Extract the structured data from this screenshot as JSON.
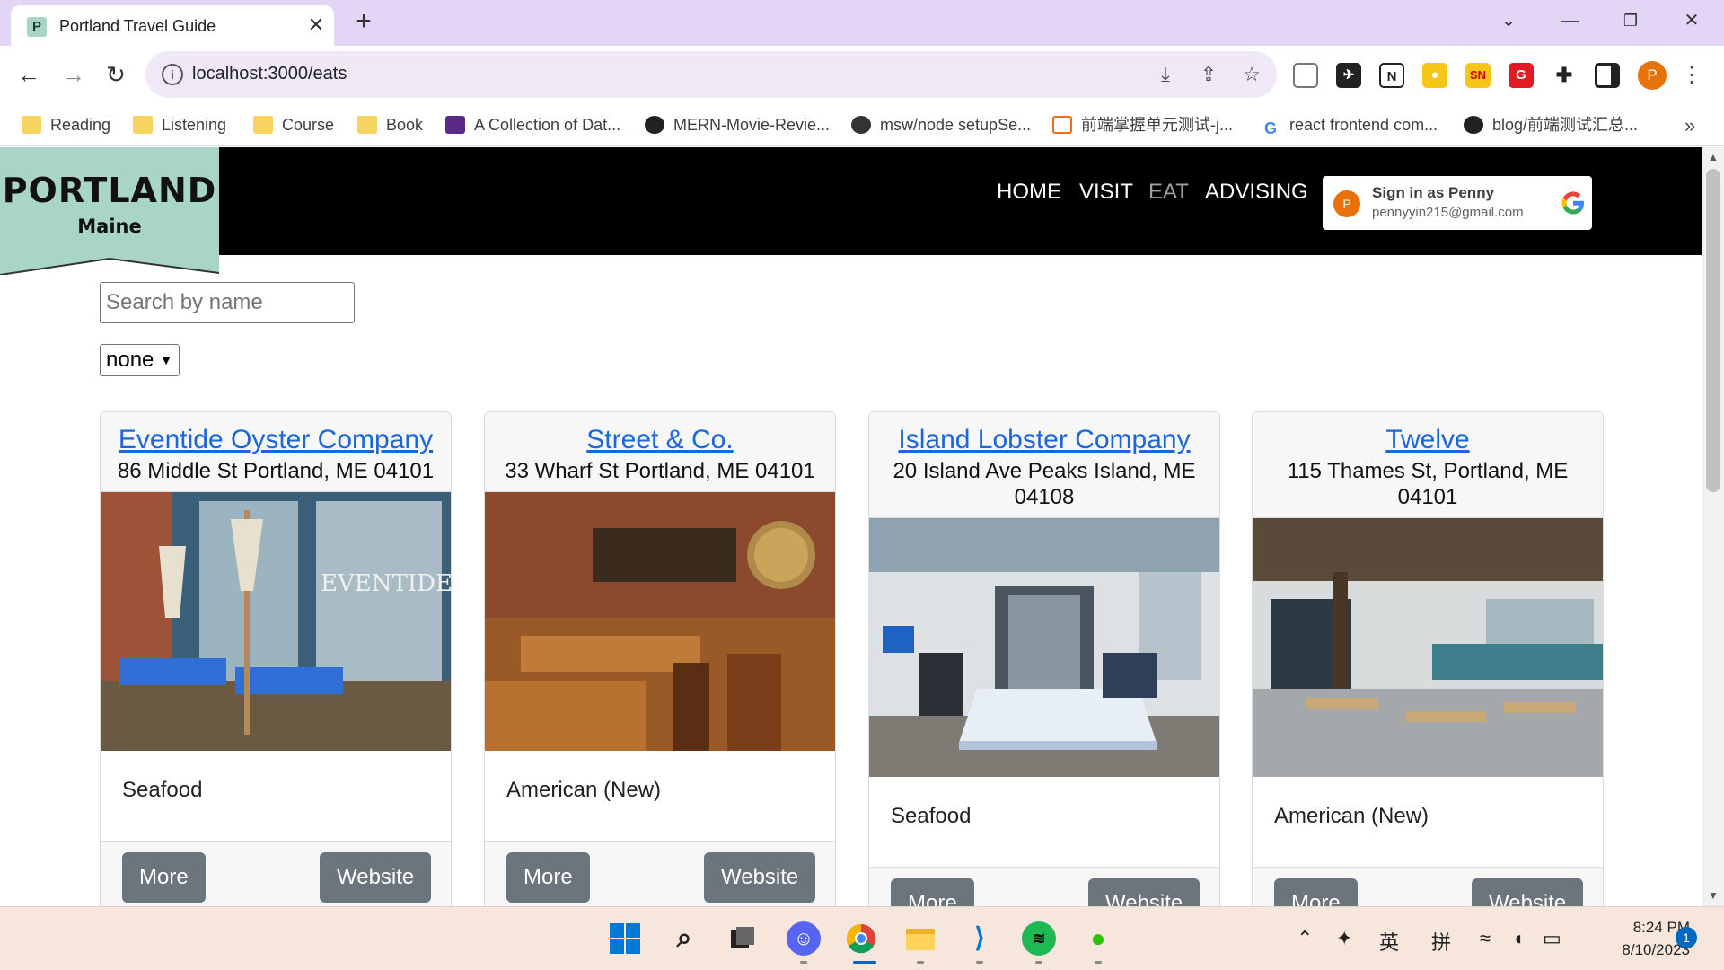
{
  "browser": {
    "tab_title": "Portland Travel Guide",
    "tab_favicon": "P",
    "url": "localhost:3000/eats",
    "profile_initial": "P",
    "bookmarks": [
      {
        "label": "Reading",
        "icon": "folder-icon"
      },
      {
        "label": "Listening",
        "icon": "folder-icon"
      },
      {
        "label": "Course",
        "icon": "folder-icon"
      },
      {
        "label": "Book",
        "icon": "folder-icon"
      },
      {
        "label": "A Collection of Dat...",
        "icon": "purple-bookmark-icon"
      },
      {
        "label": "MERN-Movie-Revie...",
        "icon": "github-icon"
      },
      {
        "label": "msw/node setupSe...",
        "icon": "globe-icon"
      },
      {
        "label": "前端掌握单元测试-j...",
        "icon": "bracket-icon"
      },
      {
        "label": "react frontend com...",
        "icon": "google-icon"
      },
      {
        "label": "blog/前端测试汇总...",
        "icon": "github-icon"
      }
    ]
  },
  "site": {
    "logo_title": "PORTLAND",
    "logo_subtitle": "Maine",
    "nav": [
      "HOME",
      "VISIT",
      "EAT",
      "ADVISING"
    ],
    "active_nav": "EAT",
    "google_signin": {
      "avatar": "P",
      "name": "Sign in as Penny",
      "email": "pennyyin215@gmail.com"
    },
    "search_placeholder": "Search by name",
    "filter_value": "none",
    "colors": {
      "header_bg": "#000000",
      "logo_bg": "#a8d5c8",
      "link": "#1a66dd",
      "button": "#6c757d"
    }
  },
  "restaurants": [
    {
      "name": "Eventide Oyster Company",
      "address": "86 Middle St Portland, ME 04101",
      "cuisine": "Seafood",
      "more": "More",
      "website": "Website",
      "image": "restaurant-patio-photo"
    },
    {
      "name": "Street & Co.",
      "address": "33 Wharf St Portland, ME 04101",
      "cuisine": "American (New)",
      "more": "More",
      "website": "Website",
      "image": "restaurant-interior-photo"
    },
    {
      "name": "Island Lobster Company",
      "address": "20 Island Ave Peaks Island, ME 04108",
      "cuisine": "Seafood",
      "more": "More",
      "website": "Website",
      "image": "deck-picnic-table-photo"
    },
    {
      "name": "Twelve",
      "address": "115 Thames St, Portland, ME 04101",
      "cuisine": "American (New)",
      "more": "More",
      "website": "Website",
      "image": "dining-room-photo"
    }
  ],
  "taskbar": {
    "time": "8:24 PM",
    "date": "8/10/2023",
    "notifications": "1",
    "ime_1": "英",
    "ime_2": "拼"
  }
}
